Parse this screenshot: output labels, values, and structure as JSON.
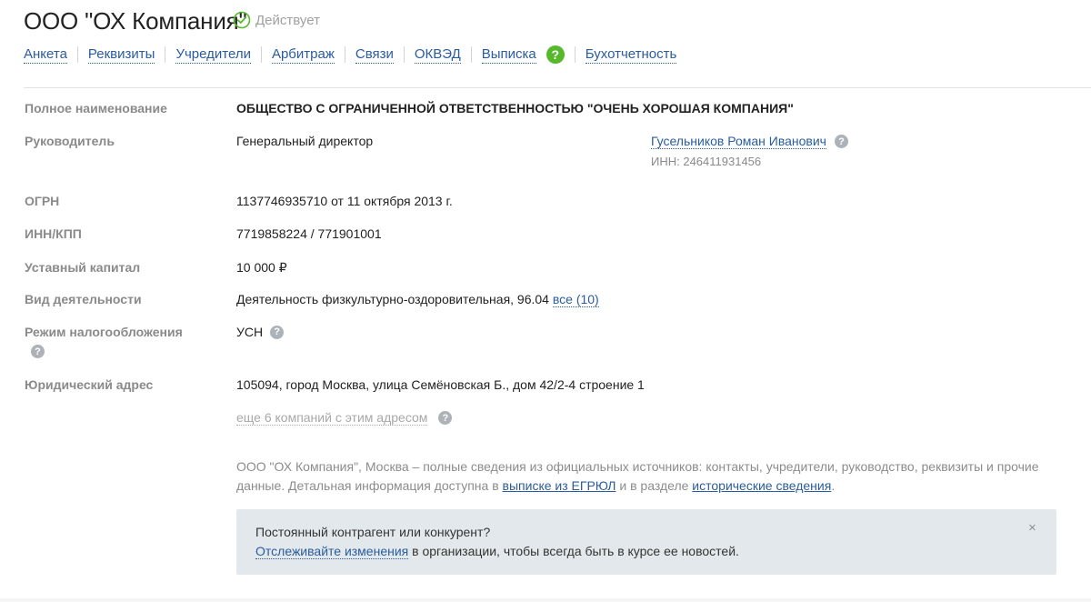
{
  "header": {
    "title": "ООО \"ОХ Компания\"",
    "status": "Действует"
  },
  "tabs": [
    {
      "label": "Анкета"
    },
    {
      "label": "Реквизиты"
    },
    {
      "label": "Учредители"
    },
    {
      "label": "Арбитраж"
    },
    {
      "label": "Связи"
    },
    {
      "label": "ОКВЭД"
    },
    {
      "label": "Выписка"
    },
    {
      "label": "Бухотчетность"
    }
  ],
  "tabs_help": "?",
  "details": {
    "full_name_label": "Полное наименование",
    "full_name_value": "ОБЩЕСТВО С ОГРАНИЧЕННОЙ ОТВЕТСТВЕННОСТЬЮ \"ОЧЕНЬ ХОРОШАЯ КОМПАНИЯ\"",
    "head_label": "Руководитель",
    "head_position": "Генеральный директор",
    "head_name": "Гусельников Роман Иванович",
    "head_inn": "ИНН: 246411931456",
    "ogrn_label": "ОГРН",
    "ogrn_value": "1137746935710 от 11 октября 2013 г.",
    "inn_label": "ИНН/КПП",
    "inn_value": "7719858224 / 771901001",
    "capital_label": "Уставный капитал",
    "capital_value": "10 000 ₽",
    "activity_label": "Вид деятельности",
    "activity_value": "Деятельность физкультурно-оздоровительная, 96.04",
    "activity_all": "все (10)",
    "tax_label": "Режим налогообложения",
    "tax_value": "УСН",
    "address_label": "Юридический адрес",
    "address_value": "105094, город Москва, улица Семёновская Б., дом 42/2-4 строение 1",
    "address_more": "еще 6 компаний с этим адресом"
  },
  "description": {
    "text_1": "ООО \"ОХ Компания\", Москва – полные сведения из официальных источников: контакты, учредители, руководство, реквизиты и прочие данные. Детальная информация доступна в ",
    "link_1": "выписке из ЕГРЮЛ",
    "text_2": " и в разделе ",
    "link_2": "исторические сведения",
    "text_3": "."
  },
  "notice": {
    "question": "Постоянный контрагент или конкурент?",
    "link": "Отслеживайте изменения",
    "text": " в организации, чтобы всегда быть в курсе ее новостей.",
    "close": "×"
  },
  "help_icon": "?",
  "colors": {
    "link": "#2a5c9e",
    "status_green": "#56b92c",
    "label_grey": "#8a8a8a",
    "notice_bg": "#e3e8ec"
  }
}
